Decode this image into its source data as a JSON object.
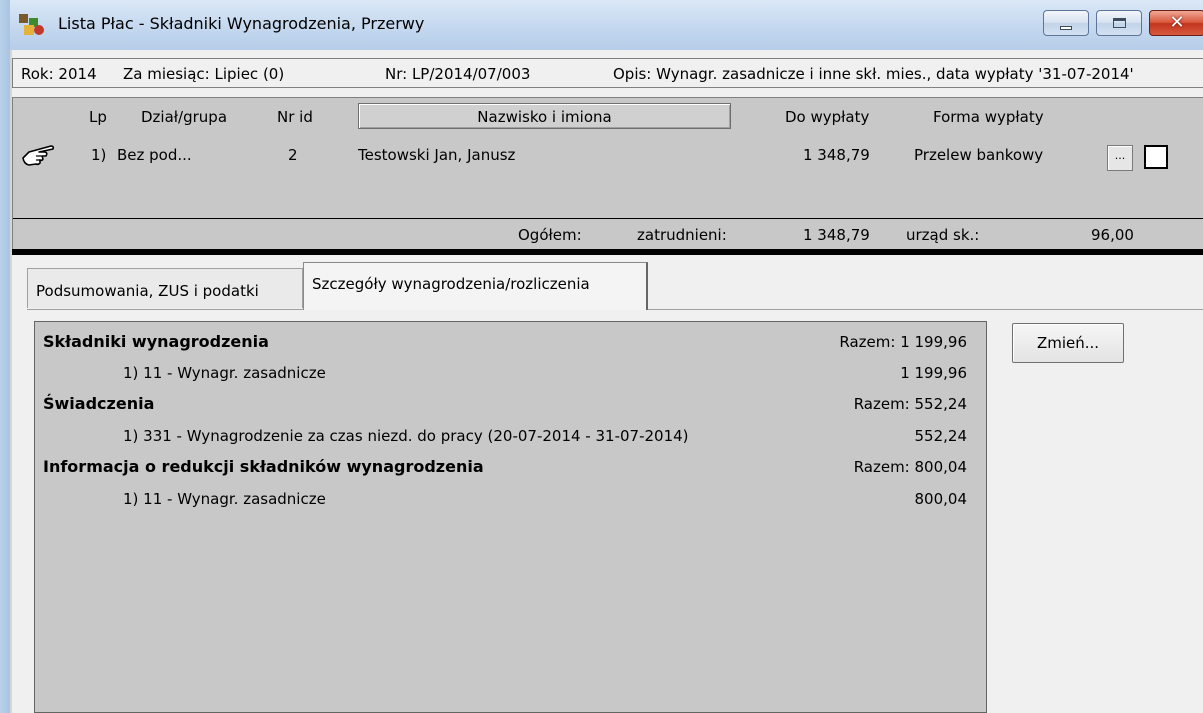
{
  "window": {
    "title": "Lista Płac - Składniki Wynagrodzenia, Przerwy",
    "controls": {
      "minimize": "minimize-icon",
      "maximize": "maximize-icon",
      "close": "close-icon"
    }
  },
  "info_bar": {
    "year": "Rok: 2014",
    "month": "Za miesiąc: Lipiec (0)",
    "number": "Nr: LP/2014/07/003",
    "description": "Opis:  Wynagr. zasadnicze i inne skł. mies., data wypłaty '31-07-2014'"
  },
  "grid": {
    "headers": {
      "lp": "Lp",
      "dept": "Dział/grupa",
      "id": "Nr id",
      "name": "Nazwisko i imiona",
      "payout": "Do wypłaty",
      "method": "Forma wypłaty"
    },
    "rows": [
      {
        "lp": "1)",
        "dept": "Bez pod...",
        "id": "2",
        "name": "Testowski Jan, Janusz",
        "payout": "1 348,79",
        "method": "Przelew bankowy",
        "details_button": "...",
        "checked": false
      }
    ],
    "totals": {
      "label": "Ogółem:",
      "employees_label": "zatrudnieni:",
      "employees_value": "1 348,79",
      "office_label": "urząd sk.:",
      "office_value": "96,00"
    }
  },
  "tabs": [
    {
      "label": "Podsumowania, ZUS i podatki",
      "active": false
    },
    {
      "label": "Szczegóły wynagrodzenia/rozliczenia",
      "active": true
    }
  ],
  "details": {
    "sections": [
      {
        "title": "Składniki wynagrodzenia",
        "total": "Razem: 1 199,96",
        "items": [
          {
            "label": "1)  11 - Wynagr. zasadnicze",
            "value": "1 199,96"
          }
        ]
      },
      {
        "title": "Świadczenia",
        "total": "Razem: 552,24",
        "items": [
          {
            "label": "1)  331 - Wynagrodzenie za czas niezd. do pracy (20-07-2014 - 31-07-2014)",
            "value": "552,24"
          }
        ]
      },
      {
        "title": "Informacja o redukcji składników wynagrodzenia",
        "total": "Razem: 800,04",
        "items": [
          {
            "label": "1)  11 - Wynagr. zasadnicze",
            "value": "800,04"
          }
        ]
      }
    ]
  },
  "buttons": {
    "change": "Zmień..."
  }
}
